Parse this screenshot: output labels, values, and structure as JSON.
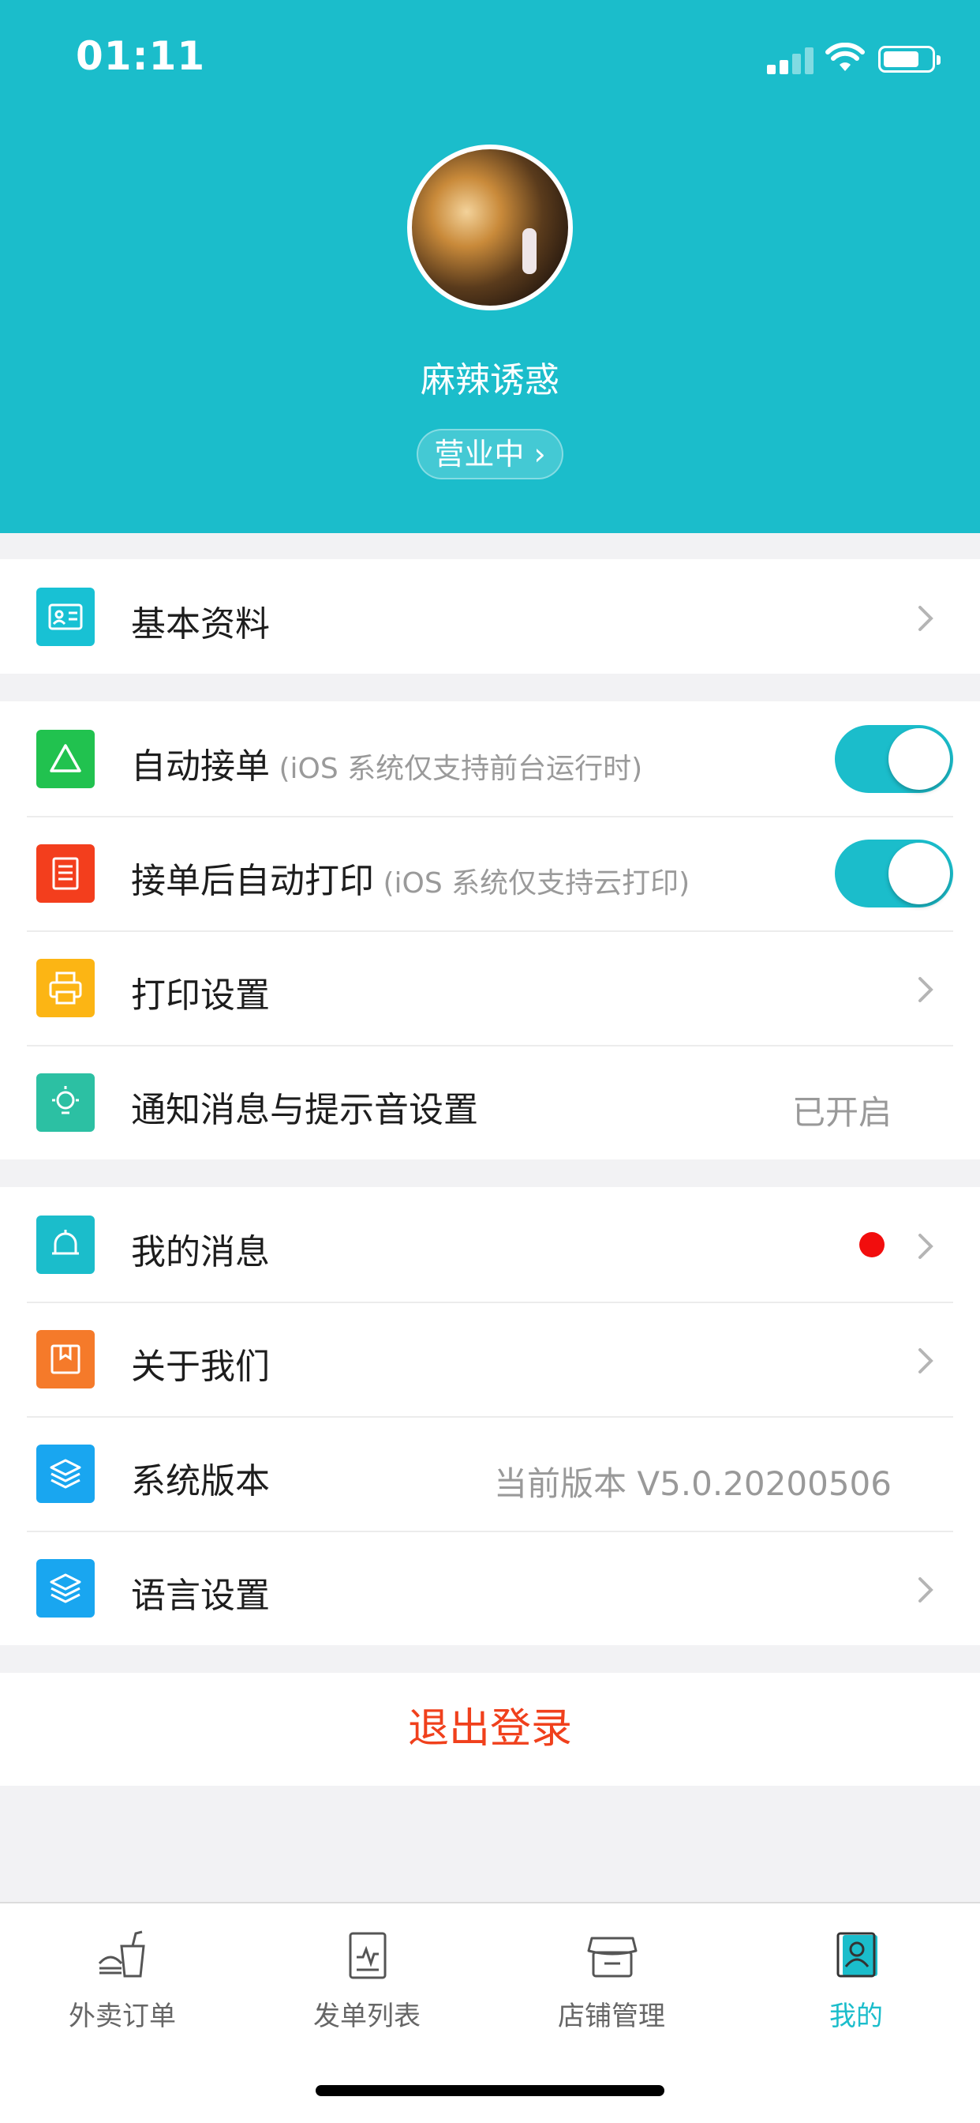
{
  "status_bar": {
    "time": "01:11"
  },
  "profile": {
    "shop_name": "麻辣诱惑",
    "status_label": "营业中 ›"
  },
  "groups": {
    "basic": {
      "label": "基本资料"
    },
    "auto_accept": {
      "label": "自动接单",
      "note": " (iOS 系统仅支持前台运行时)",
      "enabled": true
    },
    "auto_print": {
      "label": "接单后自动打印",
      "note": " (iOS 系统仅支持云打印)",
      "enabled": true
    },
    "print_settings": {
      "label": "打印设置"
    },
    "notification": {
      "label": "通知消息与提示音设置",
      "value": "已开启"
    },
    "my_messages": {
      "label": "我的消息",
      "has_unread": true
    },
    "about": {
      "label": "关于我们"
    },
    "version": {
      "label": "系统版本",
      "value": "当前版本 V5.0.20200506"
    },
    "language": {
      "label": "语言设置"
    }
  },
  "logout": {
    "label": "退出登录"
  },
  "tabbar": {
    "tabs": [
      {
        "label": "外卖订单",
        "icon": "takeout-icon"
      },
      {
        "label": "发单列表",
        "icon": "receipt-icon"
      },
      {
        "label": "店铺管理",
        "icon": "store-icon"
      },
      {
        "label": "我的",
        "icon": "profile-icon",
        "active": true
      }
    ]
  },
  "colors": {
    "accent": "#1bbdcb",
    "danger": "#f0401c",
    "badge": "#f20d0d"
  }
}
